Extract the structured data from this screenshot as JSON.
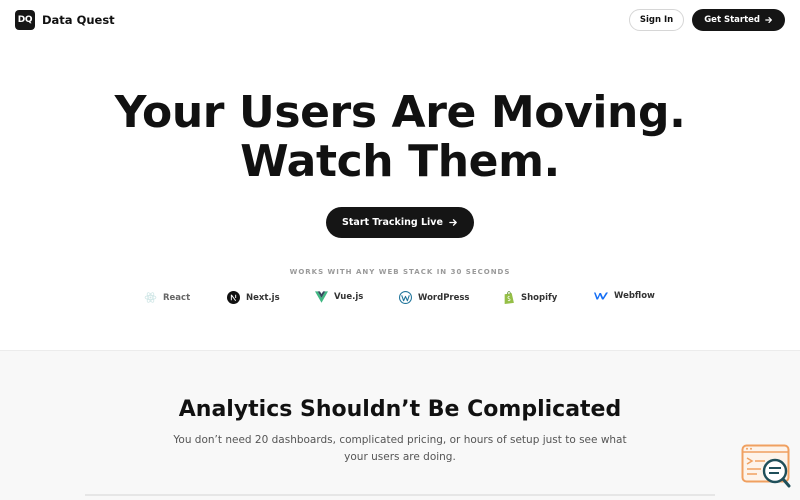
{
  "header": {
    "logo_text": "DQ",
    "brand_name": "Data Quest",
    "sign_in_label": "Sign In",
    "get_started_label": "Get Started"
  },
  "hero": {
    "title_line1": "Your Users Are Moving.",
    "title_line2": "Watch Them.",
    "cta_label": "Start Tracking Live"
  },
  "stacks": {
    "heading": "WORKS WITH ANY WEB STACK IN 30 SECONDS",
    "items": [
      {
        "label": "React",
        "icon": "react-icon"
      },
      {
        "label": "Next.js",
        "icon": "nextjs-icon"
      },
      {
        "label": "Vue.js",
        "icon": "vue-icon"
      },
      {
        "label": "WordPress",
        "icon": "wordpress-icon"
      },
      {
        "label": "Shopify",
        "icon": "shopify-icon"
      },
      {
        "label": "Webflow",
        "icon": "webflow-icon"
      }
    ]
  },
  "section2": {
    "title": "Analytics Shouldn’t Be Complicated",
    "description": "You don’t need 20 dashboards, complicated pricing, or hours of setup just to see what your users are doing."
  },
  "colors": {
    "primary": "#151515",
    "vue_green": "#41b883",
    "wordpress_blue": "#21759b",
    "shopify_green": "#95bf47",
    "webflow_blue": "#146ef5",
    "widget_orange": "#f0a060"
  }
}
